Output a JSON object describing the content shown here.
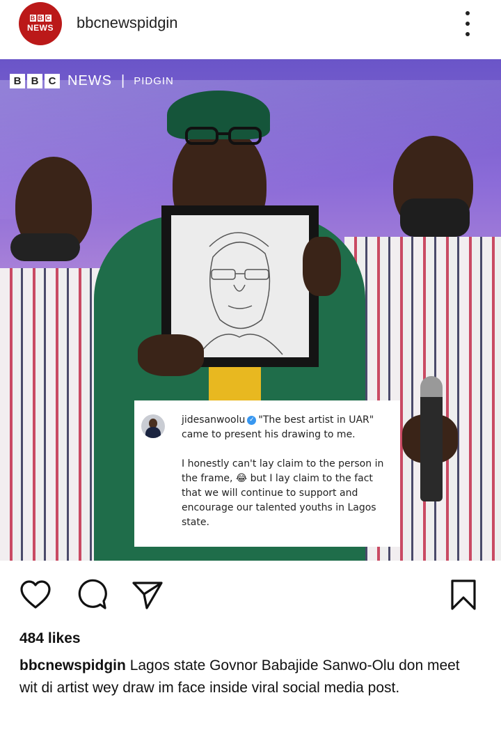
{
  "header": {
    "avatar_top": "BBC",
    "avatar_bottom": "NEWS",
    "username": "bbcnewspidgin"
  },
  "photo": {
    "watermark": {
      "b1": "B",
      "b2": "B",
      "b3": "C",
      "news": "NEWS",
      "sep": "|",
      "section": "PIDGIN"
    },
    "quote": {
      "user": "jidesanwoolu",
      "text": "\"The best artist in UAR\" came to present his drawing to me.",
      "body": "I honestly can't lay claim to the person in the frame, 😂 but I lay claim to the fact that we will continue to support and encourage our talented youths in Lagos state."
    }
  },
  "post": {
    "likes": "484 likes",
    "caption_user": "bbcnewspidgin",
    "caption_text": "Lagos state Govnor Babajide Sanwo-Olu don meet wit di artist wey draw im face inside viral social media post."
  },
  "colors": {
    "brand_red": "#bb1919",
    "verified_blue": "#3897f0"
  }
}
